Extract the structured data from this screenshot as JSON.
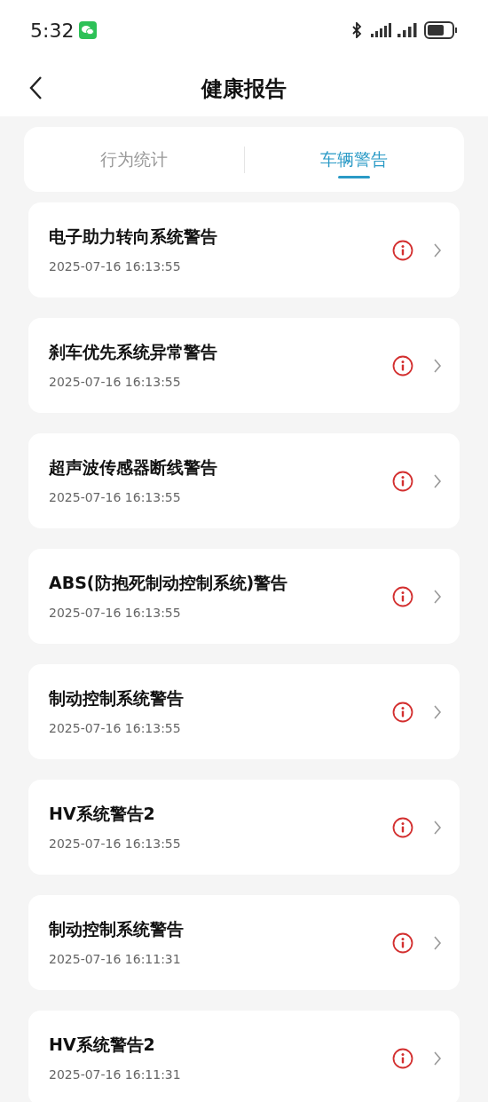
{
  "status_bar": {
    "time": "5:32"
  },
  "header": {
    "title": "健康报告"
  },
  "tabs": [
    {
      "label": "行为统计",
      "selected": false
    },
    {
      "label": "车辆警告",
      "selected": true
    }
  ],
  "warnings": [
    {
      "title": "电子助力转向系统警告",
      "time": "2025-07-16 16:13:55"
    },
    {
      "title": "刹车优先系统异常警告",
      "time": "2025-07-16 16:13:55"
    },
    {
      "title": "超声波传感器断线警告",
      "time": "2025-07-16 16:13:55"
    },
    {
      "title": "ABS(防抱死制动控制系统)警告",
      "time": "2025-07-16 16:13:55"
    },
    {
      "title": "制动控制系统警告",
      "time": "2025-07-16 16:13:55"
    },
    {
      "title": "HV系统警告2",
      "time": "2025-07-16 16:13:55"
    },
    {
      "title": "制动控制系统警告",
      "time": "2025-07-16 16:11:31"
    },
    {
      "title": "HV系统警告2",
      "time": "2025-07-16 16:11:31"
    }
  ]
}
